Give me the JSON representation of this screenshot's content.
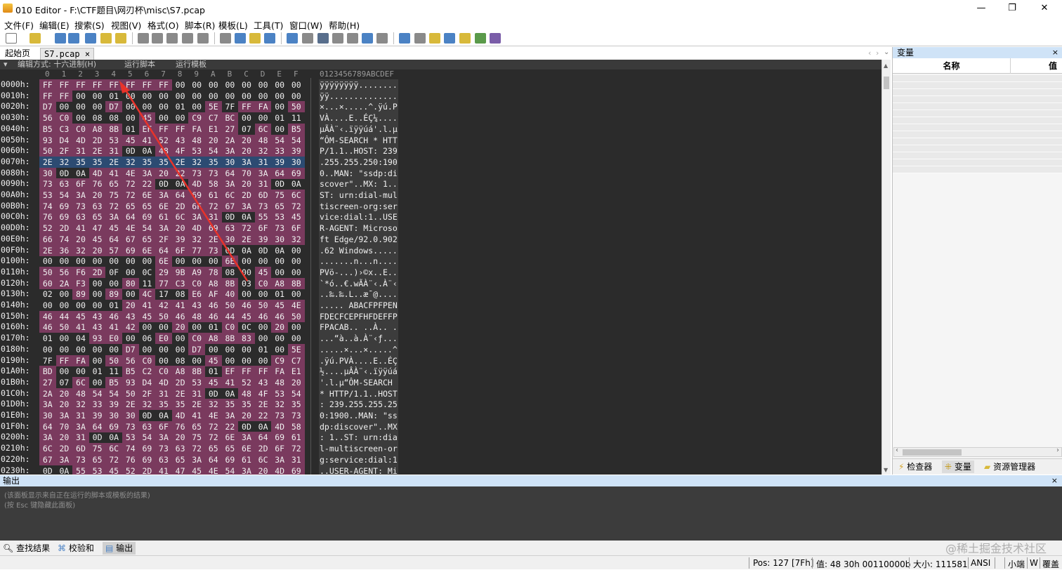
{
  "window": {
    "app_title": "010 Editor - F:\\CTF题目\\网刃杯\\misc\\S7.pcap",
    "minimize": "—",
    "maximize": "❐",
    "close": "✕"
  },
  "menu": [
    "文件(F)",
    "编辑(E)",
    "搜索(S)",
    "视图(V)",
    "格式(O)",
    "脚本(R)",
    "模板(L)",
    "工具(T)",
    "窗口(W)",
    "帮助(H)"
  ],
  "tabs": {
    "start": "起始页",
    "file": "S7.pcap",
    "file_close": "×"
  },
  "editor_bar": {
    "mode": "编辑方式: 十六进制(H)",
    "run_script": "运行脚本",
    "run_template": "运行模板"
  },
  "hex_header": [
    "0",
    "1",
    "2",
    "3",
    "4",
    "5",
    "6",
    "7",
    "8",
    "9",
    "A",
    "B",
    "C",
    "D",
    "E",
    "F"
  ],
  "ascii_header": "0123456789ABCDEF",
  "rows": [
    {
      "addr": "0000h:",
      "hex": [
        "FF",
        "FF",
        "FF",
        "FF",
        "FF",
        "FF",
        "FF",
        "FF",
        "00",
        "00",
        "00",
        "00",
        "00",
        "00",
        "00",
        "00"
      ],
      "ascii": "ÿÿÿÿÿÿÿÿ........"
    },
    {
      "addr": "0010h:",
      "hex": [
        "FF",
        "FF",
        "00",
        "00",
        "01",
        "00",
        "00",
        "00",
        "00",
        "00",
        "00",
        "00",
        "00",
        "00",
        "00",
        "00"
      ],
      "ascii": "ÿÿ.............."
    },
    {
      "addr": "0020h:",
      "hex": [
        "D7",
        "00",
        "00",
        "00",
        "D7",
        "00",
        "00",
        "00",
        "01",
        "00",
        "5E",
        "7F",
        "FF",
        "FA",
        "00",
        "50"
      ],
      "ascii": "×...×.....^.ÿú.P"
    },
    {
      "addr": "0030h:",
      "hex": [
        "56",
        "C0",
        "00",
        "08",
        "08",
        "00",
        "45",
        "00",
        "00",
        "C9",
        "C7",
        "BC",
        "00",
        "00",
        "01",
        "11"
      ],
      "ascii": "VÀ....E..ÉÇ¼...."
    },
    {
      "addr": "0040h:",
      "hex": [
        "B5",
        "C3",
        "C0",
        "A8",
        "8B",
        "01",
        "EF",
        "FF",
        "FF",
        "FA",
        "E1",
        "27",
        "07",
        "6C",
        "00",
        "B5"
      ],
      "ascii": "µÃÀ¨‹.ïÿÿúá'.l.µ"
    },
    {
      "addr": "0050h:",
      "hex": [
        "93",
        "D4",
        "4D",
        "2D",
        "53",
        "45",
        "41",
        "52",
        "43",
        "48",
        "20",
        "2A",
        "20",
        "48",
        "54",
        "54"
      ],
      "ascii": "“ÔM-SEARCH * HTT"
    },
    {
      "addr": "0060h:",
      "hex": [
        "50",
        "2F",
        "31",
        "2E",
        "31",
        "0D",
        "0A",
        "48",
        "4F",
        "53",
        "54",
        "3A",
        "20",
        "32",
        "33",
        "39"
      ],
      "ascii": "P/1.1..HOST: 239"
    },
    {
      "addr": "0070h:",
      "hex": [
        "2E",
        "32",
        "35",
        "35",
        "2E",
        "32",
        "35",
        "35",
        "2E",
        "32",
        "35",
        "30",
        "3A",
        "31",
        "39",
        "30"
      ],
      "ascii": ".255.255.250:190"
    },
    {
      "addr": "0080h:",
      "hex": [
        "30",
        "0D",
        "0A",
        "4D",
        "41",
        "4E",
        "3A",
        "20",
        "22",
        "73",
        "73",
        "64",
        "70",
        "3A",
        "64",
        "69"
      ],
      "ascii": "0..MAN: \"ssdp:di"
    },
    {
      "addr": "0090h:",
      "hex": [
        "73",
        "63",
        "6F",
        "76",
        "65",
        "72",
        "22",
        "0D",
        "0A",
        "4D",
        "58",
        "3A",
        "20",
        "31",
        "0D",
        "0A"
      ],
      "ascii": "scover\"..MX: 1.."
    },
    {
      "addr": "00A0h:",
      "hex": [
        "53",
        "54",
        "3A",
        "20",
        "75",
        "72",
        "6E",
        "3A",
        "64",
        "69",
        "61",
        "6C",
        "2D",
        "6D",
        "75",
        "6C"
      ],
      "ascii": "ST: urn:dial-mul"
    },
    {
      "addr": "00B0h:",
      "hex": [
        "74",
        "69",
        "73",
        "63",
        "72",
        "65",
        "65",
        "6E",
        "2D",
        "6F",
        "72",
        "67",
        "3A",
        "73",
        "65",
        "72"
      ],
      "ascii": "tiscreen-org:ser"
    },
    {
      "addr": "00C0h:",
      "hex": [
        "76",
        "69",
        "63",
        "65",
        "3A",
        "64",
        "69",
        "61",
        "6C",
        "3A",
        "31",
        "0D",
        "0A",
        "55",
        "53",
        "45"
      ],
      "ascii": "vice:dial:1..USE"
    },
    {
      "addr": "00D0h:",
      "hex": [
        "52",
        "2D",
        "41",
        "47",
        "45",
        "4E",
        "54",
        "3A",
        "20",
        "4D",
        "69",
        "63",
        "72",
        "6F",
        "73",
        "6F"
      ],
      "ascii": "R-AGENT: Microso"
    },
    {
      "addr": "00E0h:",
      "hex": [
        "66",
        "74",
        "20",
        "45",
        "64",
        "67",
        "65",
        "2F",
        "39",
        "32",
        "2E",
        "30",
        "2E",
        "39",
        "30",
        "32"
      ],
      "ascii": "ft Edge/92.0.902"
    },
    {
      "addr": "00F0h:",
      "hex": [
        "2E",
        "36",
        "32",
        "20",
        "57",
        "69",
        "6E",
        "64",
        "6F",
        "77",
        "73",
        "0D",
        "0A",
        "0D",
        "0A",
        "00"
      ],
      "ascii": ".62 Windows....."
    },
    {
      "addr": "0100h:",
      "hex": [
        "00",
        "00",
        "00",
        "00",
        "00",
        "00",
        "00",
        "6E",
        "00",
        "00",
        "00",
        "6E",
        "00",
        "00",
        "00",
        "00"
      ],
      "ascii": ".......n...n...."
    },
    {
      "addr": "0110h:",
      "hex": [
        "50",
        "56",
        "F6",
        "2D",
        "0F",
        "00",
        "0C",
        "29",
        "9B",
        "A9",
        "78",
        "08",
        "00",
        "45",
        "00",
        "00"
      ],
      "ascii": "PVö-...)›©x..E.."
    },
    {
      "addr": "0120h:",
      "hex": [
        "60",
        "2A",
        "F3",
        "00",
        "00",
        "80",
        "11",
        "77",
        "C3",
        "C0",
        "A8",
        "8B",
        "03",
        "C0",
        "A8",
        "8B"
      ],
      "ascii": "`*ó..€.wÃÀ¨‹.À¨‹"
    },
    {
      "addr": "0130h:",
      "hex": [
        "02",
        "00",
        "89",
        "00",
        "89",
        "00",
        "4C",
        "17",
        "08",
        "E6",
        "AF",
        "40",
        "00",
        "00",
        "01",
        "00"
      ],
      "ascii": "..‰.‰.L..æ¯@...."
    },
    {
      "addr": "0140h:",
      "hex": [
        "00",
        "00",
        "00",
        "00",
        "01",
        "20",
        "41",
        "42",
        "41",
        "43",
        "46",
        "50",
        "46",
        "50",
        "45",
        "4E"
      ],
      "ascii": "..... ABACFPFPEN"
    },
    {
      "addr": "0150h:",
      "hex": [
        "46",
        "44",
        "45",
        "43",
        "46",
        "43",
        "45",
        "50",
        "46",
        "48",
        "46",
        "44",
        "45",
        "46",
        "46",
        "50"
      ],
      "ascii": "FDECFCEPFHFDEFFP"
    },
    {
      "addr": "0160h:",
      "hex": [
        "46",
        "50",
        "41",
        "43",
        "41",
        "42",
        "00",
        "00",
        "20",
        "00",
        "01",
        "C0",
        "0C",
        "00",
        "20",
        "00"
      ],
      "ascii": "FPACAB.. ..À.. ."
    },
    {
      "addr": "0170h:",
      "hex": [
        "01",
        "00",
        "04",
        "93",
        "E0",
        "00",
        "06",
        "E0",
        "00",
        "C0",
        "A8",
        "8B",
        "83",
        "00",
        "00",
        "00"
      ],
      "ascii": "...“à..à.À¨‹ƒ..."
    },
    {
      "addr": "0180h:",
      "hex": [
        "00",
        "00",
        "00",
        "00",
        "00",
        "D7",
        "00",
        "00",
        "00",
        "D7",
        "00",
        "00",
        "00",
        "01",
        "00",
        "5E"
      ],
      "ascii": ".....×...×.....^"
    },
    {
      "addr": "0190h:",
      "hex": [
        "7F",
        "FF",
        "FA",
        "00",
        "50",
        "56",
        "C0",
        "00",
        "08",
        "00",
        "45",
        "00",
        "00",
        "00",
        "C9",
        "C7"
      ],
      "ascii": ".ÿú.PVÀ....E..ÉÇ"
    },
    {
      "addr": "01A0h:",
      "hex": [
        "BD",
        "00",
        "00",
        "01",
        "11",
        "B5",
        "C2",
        "C0",
        "A8",
        "8B",
        "01",
        "EF",
        "FF",
        "FF",
        "FA",
        "E1"
      ],
      "ascii": "½....µÂÀ¨‹.ïÿÿúá"
    },
    {
      "addr": "01B0h:",
      "hex": [
        "27",
        "07",
        "6C",
        "00",
        "B5",
        "93",
        "D4",
        "4D",
        "2D",
        "53",
        "45",
        "41",
        "52",
        "43",
        "48",
        "20"
      ],
      "ascii": "'.l.µ“ÔM-SEARCH "
    },
    {
      "addr": "01C0h:",
      "hex": [
        "2A",
        "20",
        "48",
        "54",
        "54",
        "50",
        "2F",
        "31",
        "2E",
        "31",
        "0D",
        "0A",
        "48",
        "4F",
        "53",
        "54"
      ],
      "ascii": "* HTTP/1.1..HOST"
    },
    {
      "addr": "01D0h:",
      "hex": [
        "3A",
        "20",
        "32",
        "33",
        "39",
        "2E",
        "32",
        "35",
        "35",
        "2E",
        "32",
        "35",
        "35",
        "2E",
        "32",
        "35"
      ],
      "ascii": ": 239.255.255.25"
    },
    {
      "addr": "01E0h:",
      "hex": [
        "30",
        "3A",
        "31",
        "39",
        "30",
        "30",
        "0D",
        "0A",
        "4D",
        "41",
        "4E",
        "3A",
        "20",
        "22",
        "73",
        "73"
      ],
      "ascii": "0:1900..MAN: \"ss"
    },
    {
      "addr": "01F0h:",
      "hex": [
        "64",
        "70",
        "3A",
        "64",
        "69",
        "73",
        "63",
        "6F",
        "76",
        "65",
        "72",
        "22",
        "0D",
        "0A",
        "4D",
        "58"
      ],
      "ascii": "dp:discover\"..MX"
    },
    {
      "addr": "0200h:",
      "hex": [
        "3A",
        "20",
        "31",
        "0D",
        "0A",
        "53",
        "54",
        "3A",
        "20",
        "75",
        "72",
        "6E",
        "3A",
        "64",
        "69",
        "61"
      ],
      "ascii": ": 1..ST: urn:dia"
    },
    {
      "addr": "0210h:",
      "hex": [
        "6C",
        "2D",
        "6D",
        "75",
        "6C",
        "74",
        "69",
        "73",
        "63",
        "72",
        "65",
        "65",
        "6E",
        "2D",
        "6F",
        "72"
      ],
      "ascii": "l-multiscreen-or"
    },
    {
      "addr": "0220h:",
      "hex": [
        "67",
        "3A",
        "73",
        "65",
        "72",
        "76",
        "69",
        "63",
        "65",
        "3A",
        "64",
        "69",
        "61",
        "6C",
        "3A",
        "31"
      ],
      "ascii": "g:service:dial:1"
    },
    {
      "addr": "0230h:",
      "hex": [
        "0D",
        "0A",
        "55",
        "53",
        "45",
        "52",
        "2D",
        "41",
        "47",
        "45",
        "4E",
        "54",
        "3A",
        "20",
        "4D",
        "69"
      ],
      "ascii": "..USER-AGENT: Mi"
    }
  ],
  "variables_panel": {
    "title": "变量",
    "close": "×",
    "col_name": "名称",
    "col_value": "值",
    "tabs": [
      "检查器",
      "变量",
      "资源管理器"
    ]
  },
  "output_panel": {
    "title": "输出",
    "close": "×",
    "line1": "(该面板显示来自正在运行的脚本或模板的结果)",
    "line2": "(按 Esc 键隐藏此面板)"
  },
  "bottom_tabs": [
    "查找结果",
    "校验和",
    "输出"
  ],
  "watermark": "@稀土掘金技术社区",
  "status": {
    "pos": "Pos: 127 [7Fh]",
    "value": "值: 48 30h 00110000b",
    "size": "大小: 111581",
    "encoding": "ANSI",
    "endian": "小端",
    "w": "W",
    "mode": "覆盖"
  },
  "colors": {
    "hex_bg": "#2b2b2b",
    "highlight": "#7a3a5e",
    "selection": "#2c4b72",
    "annotation_arrow": "#e8332a"
  }
}
